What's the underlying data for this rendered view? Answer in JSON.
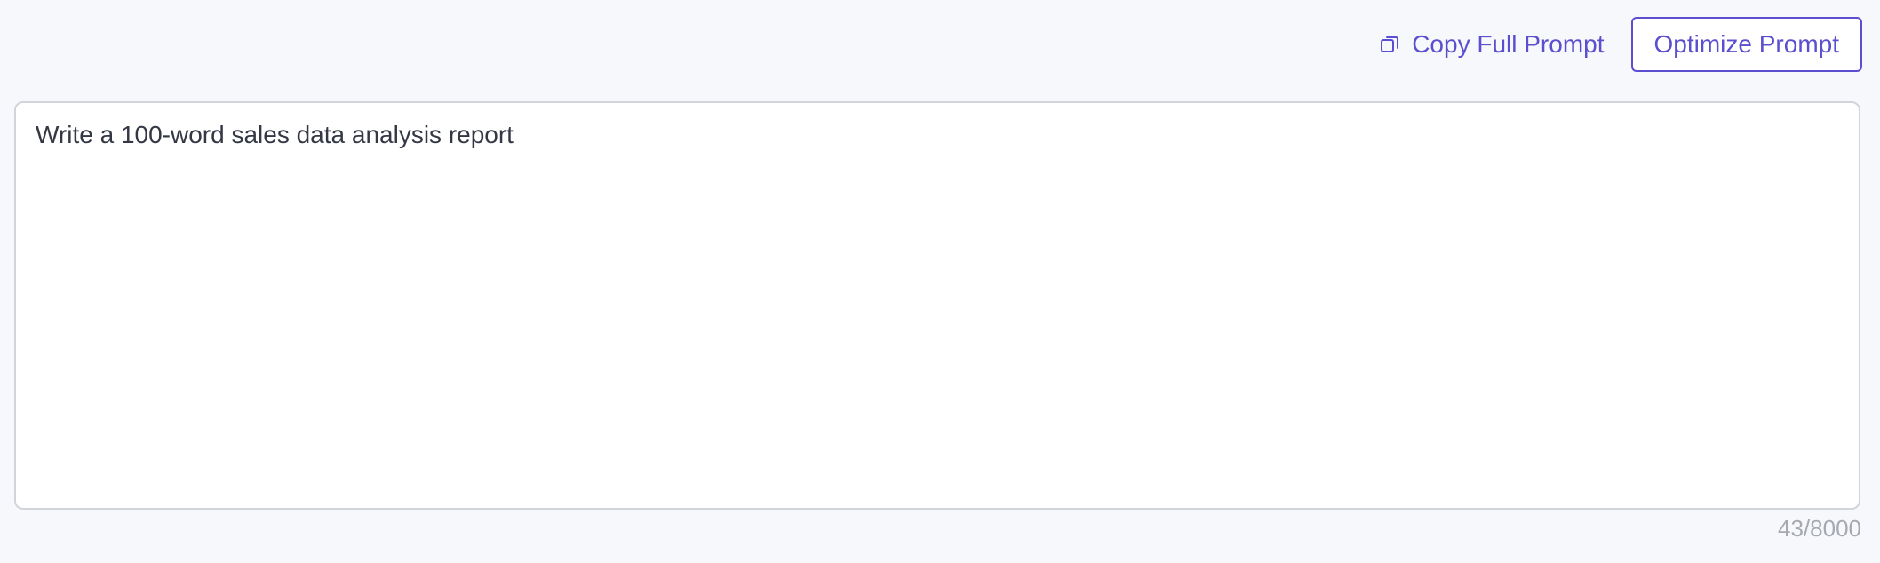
{
  "toolbar": {
    "copy_label": "Copy Full Prompt",
    "optimize_label": "Optimize Prompt",
    "copy_icon": "copy-icon"
  },
  "editor": {
    "value": "Write a 100-word sales data analysis report",
    "char_count": "43/8000"
  },
  "colors": {
    "accent": "#5b4fcf",
    "border": "#d1d4db",
    "text": "#343845",
    "muted": "#a6a9b1",
    "background": "#f7f8fb"
  }
}
